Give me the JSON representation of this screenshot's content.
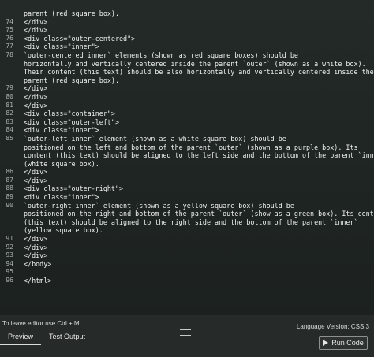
{
  "editor": {
    "lines": [
      {
        "n": "",
        "t": "parent (red square box)."
      },
      {
        "n": "74",
        "t": "            </div>"
      },
      {
        "n": "75",
        "t": "        </div>"
      },
      {
        "n": "76",
        "t": "        <div class=\"outer-centered\">"
      },
      {
        "n": "77",
        "t": "            <div class=\"inner\">"
      },
      {
        "n": "78",
        "t": "                `outer-centered inner` elements (shown as red square boxes) should be"
      },
      {
        "n": "",
        "t": "horizontally and vertically centered inside the parent `outer` (shown as a white box)."
      },
      {
        "n": "",
        "t": "Their content (this text) should be also horizontally and vertically centered inside the"
      },
      {
        "n": "",
        "t": "parent (red square box)."
      },
      {
        "n": "79",
        "t": "            </div>"
      },
      {
        "n": "80",
        "t": "        </div>"
      },
      {
        "n": "81",
        "t": "    </div>"
      },
      {
        "n": "82",
        "t": "    <div class=\"container\">"
      },
      {
        "n": "83",
        "t": "        <div class=\"outer-left\">"
      },
      {
        "n": "84",
        "t": "            <div class=\"inner\">"
      },
      {
        "n": "85",
        "t": "                `outer-left inner` element (shown as a white square box) should be"
      },
      {
        "n": "",
        "t": "positioned on the left and bottom of the parent `outer` (shown as a purple box). Its"
      },
      {
        "n": "",
        "t": "content (this text) should be aligned to the left side and the bottom of the parent `inner`"
      },
      {
        "n": "",
        "t": "(white square box)."
      },
      {
        "n": "86",
        "t": "            </div>"
      },
      {
        "n": "87",
        "t": "        </div>"
      },
      {
        "n": "88",
        "t": "        <div class=\"outer-right\">"
      },
      {
        "n": "89",
        "t": "            <div class=\"inner\">"
      },
      {
        "n": "90",
        "t": "                `outer-right inner` element (shown as a yellow square box) should be"
      },
      {
        "n": "",
        "t": "positioned on the right and bottom of the parent `outer` (show as a green box). Its content"
      },
      {
        "n": "",
        "t": "(this text) should be aligned to the right side and the bottom of the parent `inner`"
      },
      {
        "n": "",
        "t": "(yellow square box)."
      },
      {
        "n": "91",
        "t": "            </div>"
      },
      {
        "n": "92",
        "t": "        </div>"
      },
      {
        "n": "93",
        "t": "    </div>"
      },
      {
        "n": "94",
        "t": "</body>"
      },
      {
        "n": "95",
        "t": ""
      },
      {
        "n": "96",
        "t": "</html>"
      }
    ]
  },
  "status": {
    "leave_hint": "To leave editor use Ctrl + M",
    "language": "Language Version: CSS 3"
  },
  "tabs": [
    {
      "label": "Preview",
      "active": true
    },
    {
      "label": "Test Output",
      "active": false
    }
  ],
  "run_button": {
    "label": "Run Code",
    "icon": "play-icon"
  }
}
